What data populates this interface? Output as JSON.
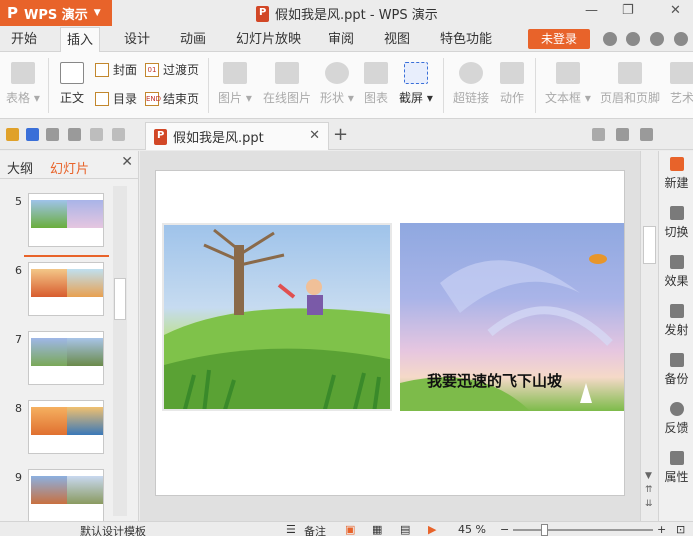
{
  "app": {
    "name": "WPS 演示",
    "logo": "P"
  },
  "window": {
    "title": "假如我是风.ppt - WPS 演示",
    "minimize": "—",
    "restore": "❐",
    "close": "✕"
  },
  "menu": {
    "tabs": [
      "开始",
      "插入",
      "设计",
      "动画",
      "幻灯片放映",
      "审阅",
      "视图",
      "特色功能"
    ],
    "active": "插入",
    "login": "未登录"
  },
  "ribbon": {
    "table": "表格",
    "body_text": "正文",
    "cover": "封面",
    "toc": "目录",
    "transition_page": "过渡页",
    "end_page": "结束页",
    "picture": "图片",
    "online_picture": "在线图片",
    "shape": "形状",
    "chart": "图表",
    "screenshot": "截屏",
    "hyperlink": "超链接",
    "action": "动作",
    "textbox": "文本框",
    "header_footer": "页眉和页脚",
    "art": "艺术"
  },
  "document_tab": {
    "name": "假如我是风.ppt",
    "close": "✕",
    "add": "+"
  },
  "left_panel": {
    "tab_outline": "大纲",
    "tab_slides": "幻灯片",
    "close": "✕",
    "slides": [
      "5",
      "6",
      "7",
      "8",
      "9"
    ]
  },
  "slide": {
    "caption": "我要迅速的飞下山坡"
  },
  "right_bar": {
    "items": [
      "新建",
      "切换",
      "效果",
      "发射",
      "备份",
      "反馈",
      "属性"
    ]
  },
  "status": {
    "template": "默认设计模板",
    "notes": "备注",
    "zoom": "45 %",
    "zoom_out": "−",
    "zoom_in": "+",
    "zoom_level": 0.2
  },
  "colors": {
    "accent": "#e8632a",
    "ribbon_bg": "#fafafa",
    "chrome_bg": "#ececec"
  }
}
